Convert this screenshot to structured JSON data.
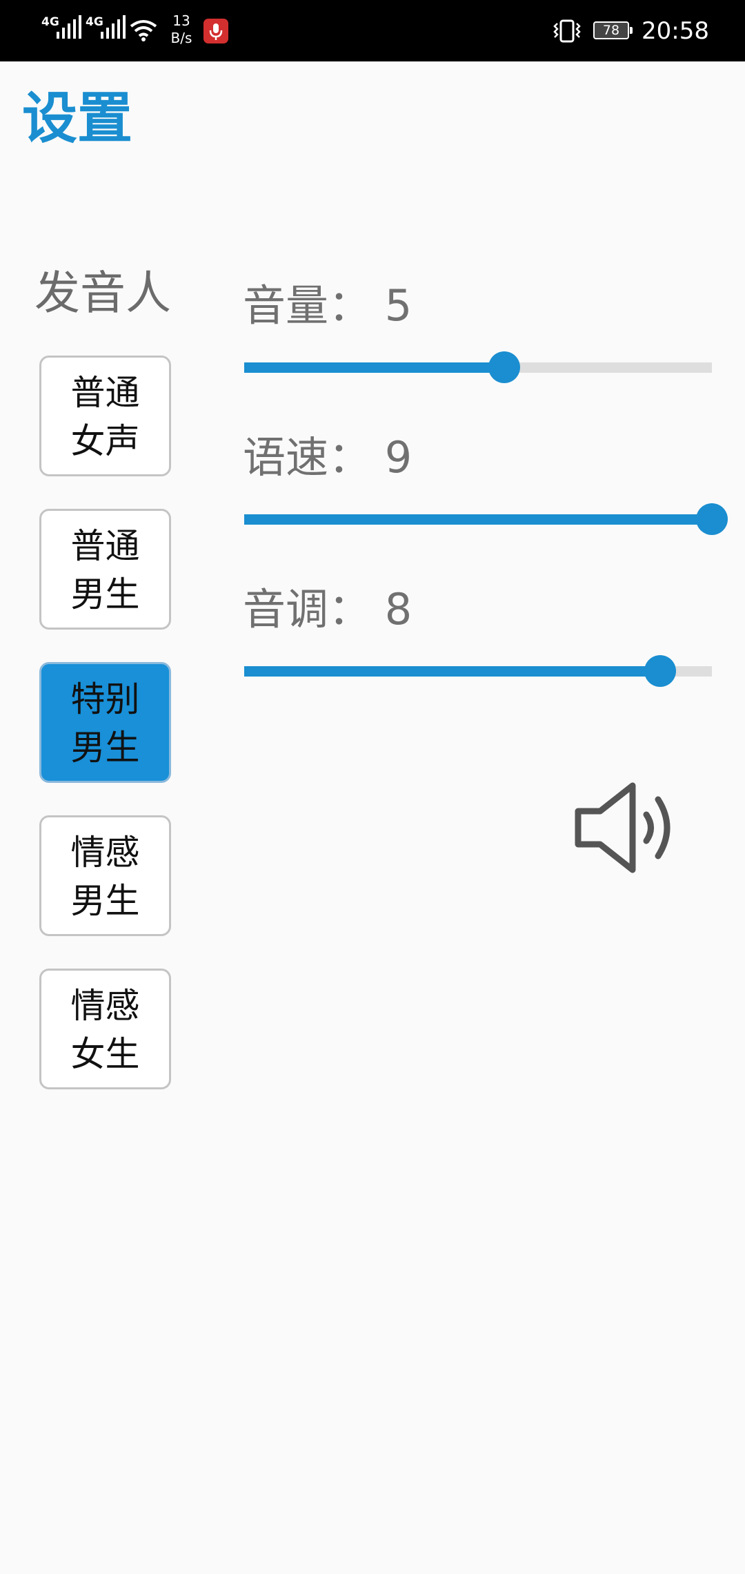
{
  "status_bar": {
    "signal1_label": "4G",
    "signal2_label": "4G",
    "net_speed_value": "13",
    "net_speed_unit": "B/s",
    "battery": "78",
    "time": "20:58"
  },
  "page": {
    "title": "设置",
    "title_color": "#1a8ed0"
  },
  "voices": {
    "label": "发音人",
    "items": [
      {
        "label": "普通\n女声",
        "selected": false
      },
      {
        "label": "普通\n男生",
        "selected": false
      },
      {
        "label": "特别\n男生",
        "selected": true
      },
      {
        "label": "情感\n男生",
        "selected": false
      },
      {
        "label": "情感\n女生",
        "selected": false
      }
    ]
  },
  "params": [
    {
      "name": "音量",
      "value": 5,
      "display": "音量： 5",
      "level": 0.5556
    },
    {
      "name": "语速",
      "value": 9,
      "display": "语速： 9",
      "level": 1.0
    },
    {
      "name": "音调",
      "value": 8,
      "display": "音调： 8",
      "level": 0.8889
    }
  ],
  "icons": {
    "speaker": "speaker-volume-icon",
    "mic": "microphone-icon",
    "vibrate": "vibrate-icon",
    "wifi": "wifi-icon"
  },
  "colors": {
    "accent": "#1a8ed0",
    "selected_button": "#1990d8",
    "track": "#dedede"
  }
}
